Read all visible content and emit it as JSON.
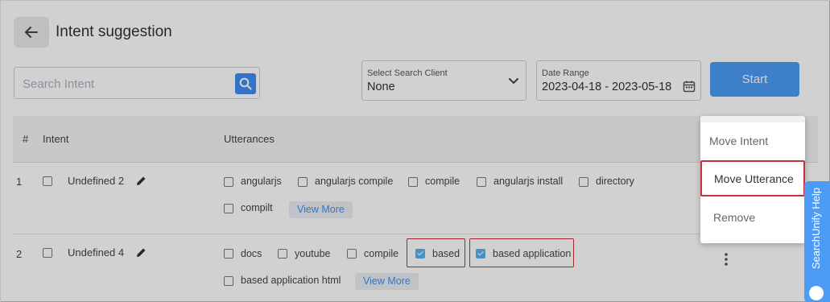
{
  "header": {
    "title": "Intent suggestion"
  },
  "search": {
    "placeholder": "Search Intent",
    "value": ""
  },
  "client_select": {
    "label": "Select Search Client",
    "value": "None"
  },
  "date_range": {
    "label": "Date Range",
    "value": "2023-04-18 - 2023-05-18"
  },
  "start_label": "Start",
  "table": {
    "headers": {
      "num": "#",
      "intent": "Intent",
      "utterances": "Utterances"
    },
    "rows": [
      {
        "num": "1",
        "intent": "Undefined 2",
        "utterances": [
          "angularjs",
          "angularjs compile",
          "compile",
          "angularjs install",
          "directory",
          "compilt"
        ],
        "view_more": "View More"
      },
      {
        "num": "2",
        "intent": "Undefined 4",
        "utterances": [
          "docs",
          "youtube",
          "compile",
          "based",
          "based application",
          "based application html"
        ],
        "view_more": "View More"
      }
    ]
  },
  "menu": {
    "items": [
      "Move Intent",
      "Move Utterance",
      "Remove"
    ]
  },
  "help_tab": {
    "label": "SearchUnify Help"
  },
  "colors": {
    "accent": "#4c9cf6",
    "highlight": "#c9303a",
    "checked": "#5cb0ee"
  }
}
